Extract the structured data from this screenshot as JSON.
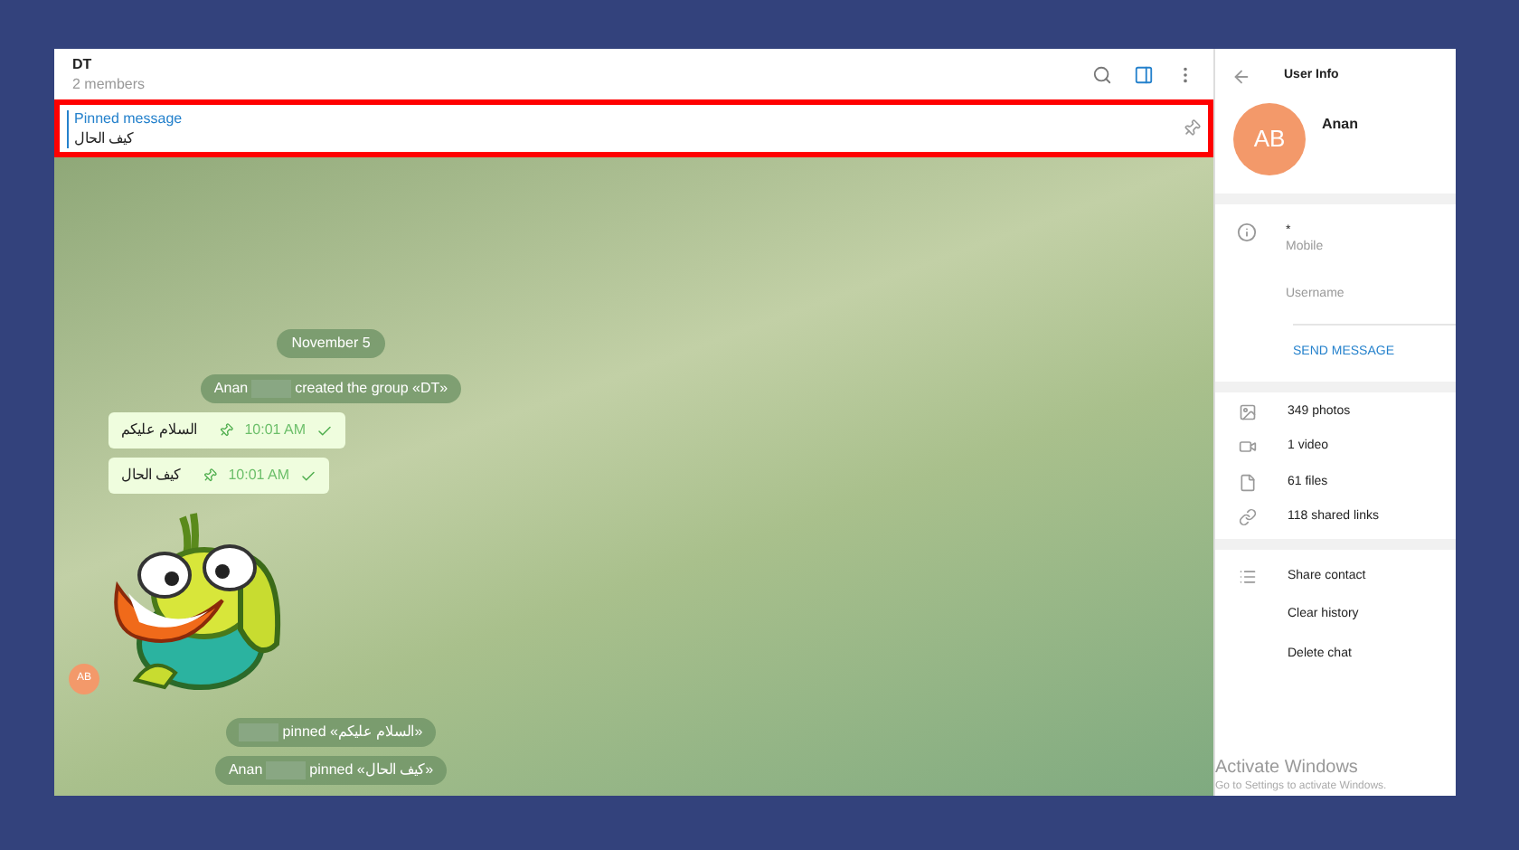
{
  "chat_header": {
    "title": "DT",
    "subtitle": "2 members",
    "sidebar_toggle": {
      "selected": true
    }
  },
  "pinned": {
    "label": "Pinned message",
    "text": "كيف الحال"
  },
  "messages": [
    {
      "kind": "date",
      "text": "November 5"
    },
    {
      "kind": "service",
      "name": "Anan",
      "text": "created the group «DT»"
    },
    {
      "kind": "outgoing",
      "text": "السلام عليكم",
      "time": "10:01 AM",
      "pinned": true,
      "read": true
    },
    {
      "kind": "outgoing",
      "text": "كيف الحال",
      "time": "10:01 AM",
      "pinned": true,
      "read": true
    },
    {
      "kind": "sticker",
      "avatar": "AB"
    },
    {
      "kind": "service",
      "text": "pinned «السلام عليكم»"
    },
    {
      "kind": "service",
      "name": "Anan",
      "text": "pinned «كيف الحال»"
    }
  ],
  "user_info": {
    "title": "User Info",
    "avatar": "AB",
    "name": "Anan",
    "phone": "*",
    "phone_label": "Mobile",
    "username_label": "Username",
    "send_message": "SEND MESSAGE",
    "media": [
      {
        "kind": "photos",
        "text": "349 photos"
      },
      {
        "kind": "video",
        "text": "1 video"
      },
      {
        "kind": "files",
        "text": "61 files"
      },
      {
        "kind": "links",
        "text": "118 shared links"
      }
    ],
    "actions": [
      "Share contact",
      "Clear history",
      "Delete chat"
    ]
  },
  "os_overlay": {
    "title": "Activate Windows",
    "text": "Go to Settings to activate Windows."
  }
}
